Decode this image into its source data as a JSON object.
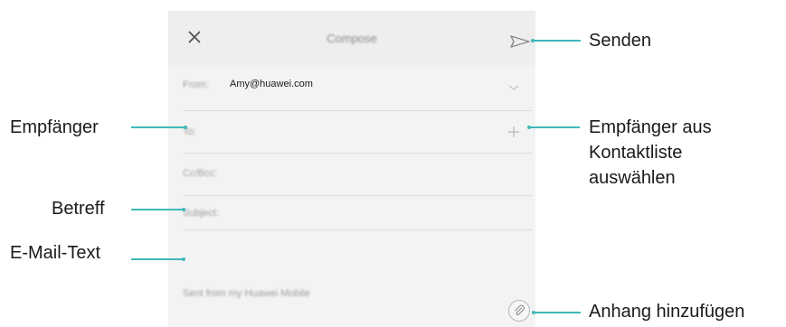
{
  "compose": {
    "title": "Compose",
    "from_label": "From:",
    "from_value": "Amy@huawei.com",
    "to_label": "To:",
    "ccbcc_label": "Cc/Bcc:",
    "subject_label": "Subject:",
    "signature": "Sent from my Huawei Mobile"
  },
  "callouts": {
    "send": "Senden",
    "recipient": "Empfänger",
    "recipient_contacts": [
      "Empfänger aus",
      "Kontaktliste",
      "auswählen"
    ],
    "subject": "Betreff",
    "body": "E-Mail-Text",
    "attach": "Anhang hinzufügen"
  },
  "colors": {
    "accent_line": "#3fb8b8",
    "screen_bg": "#f3f3f3"
  },
  "icons": {
    "close": "close-icon",
    "send": "send-icon",
    "dropdown": "chevron-down-icon",
    "add_contact": "plus-icon",
    "attach": "paperclip-icon"
  }
}
